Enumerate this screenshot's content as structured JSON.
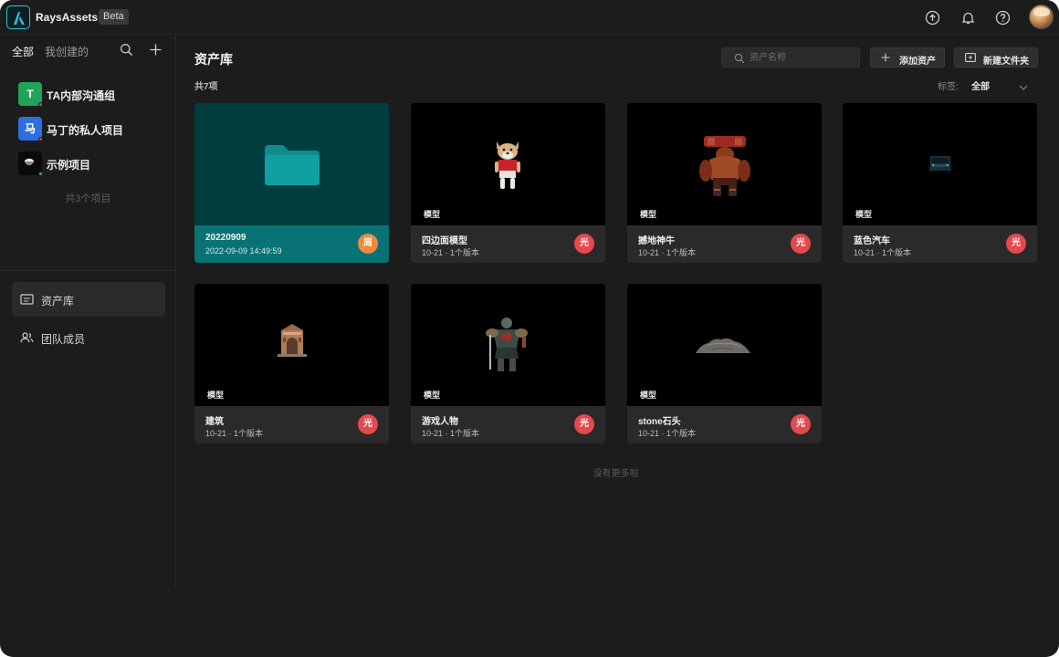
{
  "topbar": {
    "app_name": "RaysAssets",
    "beta_label": "Beta",
    "icons": [
      "upload-icon",
      "bell-icon",
      "help-icon"
    ]
  },
  "sidebar": {
    "tabs": [
      "全部",
      "我创建的"
    ],
    "projects": [
      {
        "badge": "T",
        "name": "TA内部沟通组",
        "color": "#1fa45a",
        "dot": "#e0484a"
      },
      {
        "badge": "马",
        "name": "马丁的私人项目",
        "color": "#2e6fe0",
        "dot": "#e0484a"
      },
      {
        "badge": "",
        "name": "示例项目",
        "color": "#0a0a0a",
        "dot": "#2bb673"
      }
    ],
    "project_count": "共3个项目",
    "nav": [
      {
        "label": "资产库",
        "icon": "folder-list-icon",
        "active": true
      },
      {
        "label": "团队成员",
        "icon": "team-icon",
        "active": false
      }
    ]
  },
  "main": {
    "title": "资产库",
    "search_placeholder": "资产名称",
    "add_asset_label": "添加资产",
    "new_folder_label": "新建文件夹",
    "total": "共7项",
    "tag_label": "标签:",
    "tag_value": "全部",
    "no_more": "没有更多啦"
  },
  "cards": [
    {
      "kind": "folder",
      "name": "20220909",
      "meta": "2022-09-09 14:49:59",
      "avatar": "周",
      "avatar_color": "#f08a3c"
    },
    {
      "kind": "model",
      "type_tag": "模型",
      "name": "四边面模型",
      "meta": "10-21 · 1个版本",
      "avatar": "光",
      "avatar_color": "#e5484d",
      "art": "dog-model-icon"
    },
    {
      "kind": "model",
      "type_tag": "模型",
      "name": "撼地神牛",
      "meta": "10-21 · 1个版本",
      "avatar": "光",
      "avatar_color": "#e5484d",
      "art": "bull-warrior-model-icon"
    },
    {
      "kind": "model",
      "type_tag": "模型",
      "name": "蓝色汽车",
      "meta": "10-21 · 1个版本",
      "avatar": "光",
      "avatar_color": "#e5484d",
      "art": "blue-car-model-icon"
    },
    {
      "kind": "model",
      "type_tag": "模型",
      "name": "建筑",
      "meta": "10-21 · 1个版本",
      "avatar": "光",
      "avatar_color": "#e5484d",
      "art": "building-model-icon"
    },
    {
      "kind": "model",
      "type_tag": "模型",
      "name": "游戏人物",
      "meta": "10-21 · 1个版本",
      "avatar": "光",
      "avatar_color": "#e5484d",
      "art": "game-character-model-icon"
    },
    {
      "kind": "model",
      "type_tag": "模型",
      "name": "stone石头",
      "meta": "10-21 · 1个版本",
      "avatar": "光",
      "avatar_color": "#e5484d",
      "art": "stone-model-icon"
    }
  ]
}
